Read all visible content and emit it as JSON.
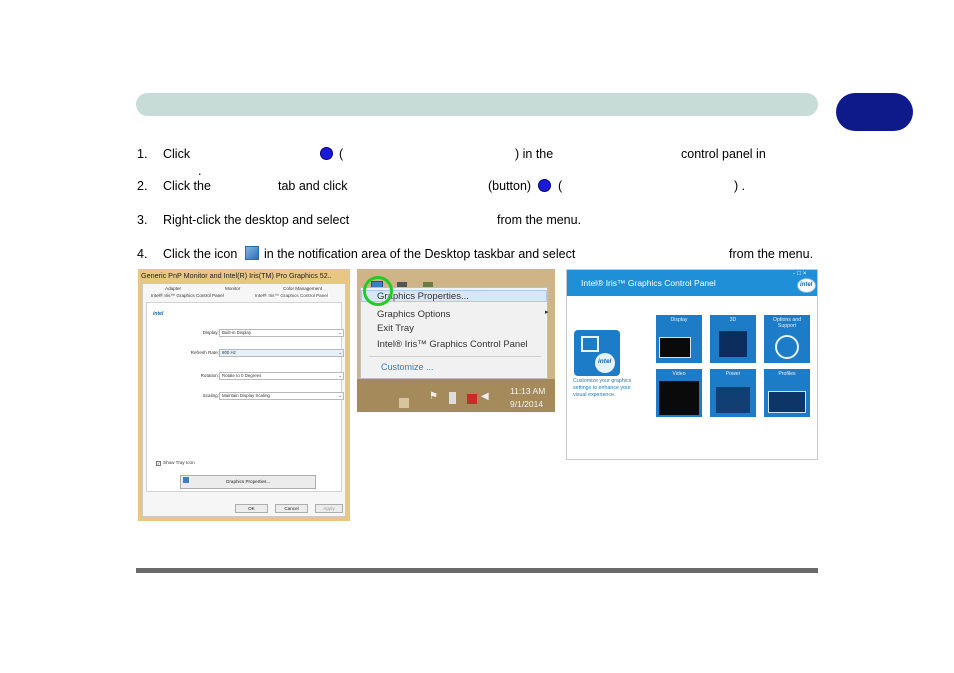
{
  "steps": [
    {
      "num": "1.",
      "a": "Click",
      "b": "(",
      "c": ") in the",
      "d": "control panel in",
      "e": "."
    },
    {
      "num": "2.",
      "a": "Click the",
      "b": "tab and click",
      "c": "(button)",
      "d": "(",
      "e": ") ."
    },
    {
      "num": "3.",
      "a": "Right-click the desktop and select",
      "b": "from the menu."
    },
    {
      "num": "4.",
      "a": "Click the icon",
      "b": "in the notification area of the Desktop taskbar and select",
      "c": "from the menu."
    }
  ],
  "dialog": {
    "title": "Generic PnP Monitor and Intel(R) Iris(TM) Pro Graphics 52..",
    "tabs_row1": [
      "Adapter",
      "Monitor",
      "Color Management"
    ],
    "tabs_row2": [
      "Intel® Iris™ Graphics Control Panel",
      "Intel® Iris™ Graphics Control Panel"
    ],
    "logo": "intel",
    "fields": [
      {
        "label": "Display:",
        "value": "Built-in Display"
      },
      {
        "label": "Refresh Rate:",
        "value": "800 Hz"
      },
      {
        "label": "Rotation:",
        "value": "Rotate to 0 Degrees"
      },
      {
        "label": "Scaling:",
        "value": "Maintain Display Scaling"
      }
    ],
    "checkbox_label": "Show Tray Icon",
    "graphics_button": "Graphics Properties...",
    "ok": "OK",
    "cancel": "Cancel",
    "apply": "Apply"
  },
  "tray_menu": {
    "items": [
      "Graphics Properties...",
      "Graphics Options",
      "Exit Tray",
      "Intel® Iris™ Graphics Control Panel"
    ],
    "customize": "Customize ...",
    "time": "11:13 AM",
    "date": "9/1/2014",
    "highlight_color": "#22cc22"
  },
  "iris": {
    "title": "Intel® Iris™ Graphics Control Panel",
    "window_controls": "- □ ×",
    "logo": "intel",
    "tagline": "Customize your graphics settings to enhance your visual experience.",
    "tiles": [
      "Display",
      "3D",
      "Options and Support",
      "Video",
      "Power",
      "Profiles"
    ],
    "accent_color": "#1f8fd7"
  }
}
